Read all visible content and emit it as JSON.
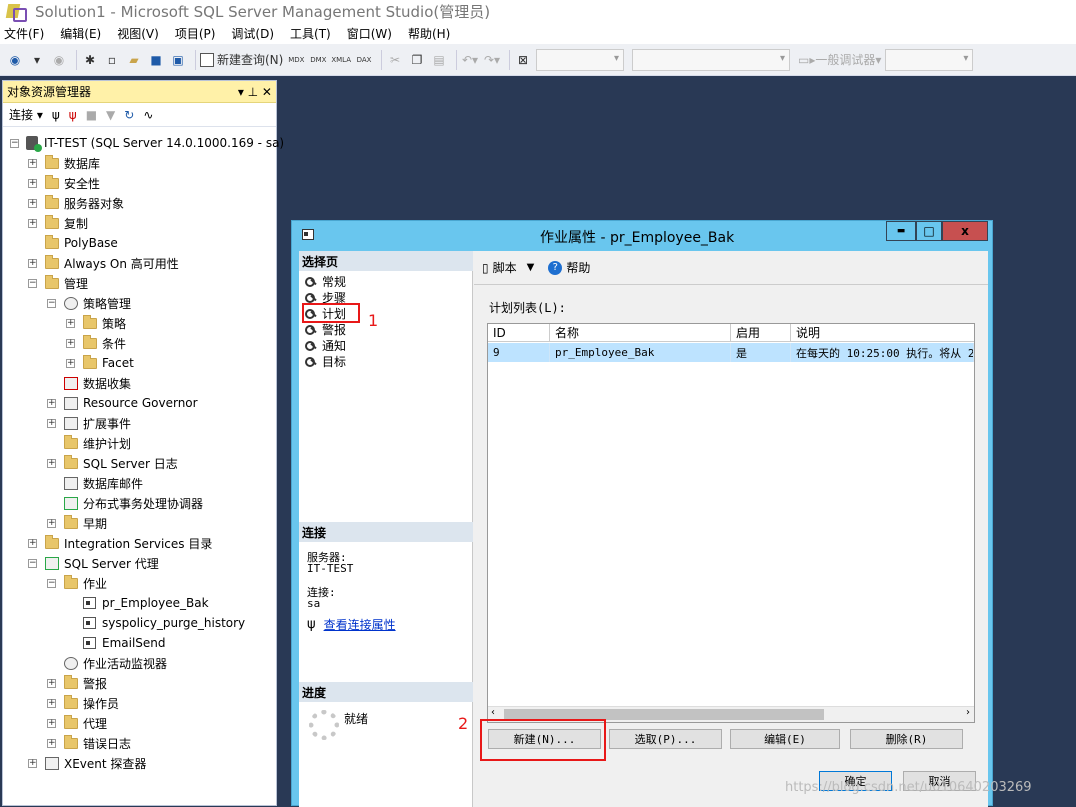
{
  "window": {
    "title": "Solution1 - Microsoft SQL Server Management Studio(管理员)"
  },
  "menu": [
    "文件(F)",
    "编辑(E)",
    "视图(V)",
    "项目(P)",
    "调试(D)",
    "工具(T)",
    "窗口(W)",
    "帮助(H)"
  ],
  "toolbar": {
    "new_query": "新建查询(N)",
    "mdx": "MDX",
    "dmx": "DMX",
    "xmla": "XMLA",
    "dax": "DAX",
    "debugger": "一般调试器"
  },
  "object_explorer": {
    "title": "对象资源管理器",
    "pin": "▾ ⊥ ✕",
    "connect": "连接",
    "nodes": [
      "IT-TEST (SQL Server 14.0.1000.169 - sa)",
      "数据库",
      "安全性",
      "服务器对象",
      "复制",
      "PolyBase",
      "Always On 高可用性",
      "管理",
      "策略管理",
      "策略",
      "条件",
      "Facet",
      "数据收集",
      "Resource Governor",
      "扩展事件",
      "维护计划",
      "SQL Server 日志",
      "数据库邮件",
      "分布式事务处理协调器",
      "早期",
      "Integration Services 目录",
      "SQL Server 代理",
      "作业",
      "pr_Employee_Bak",
      "syspolicy_purge_history",
      "EmailSend",
      "作业活动监视器",
      "警报",
      "操作员",
      "代理",
      "错误日志",
      "XEvent 探查器"
    ]
  },
  "dialog": {
    "title": "作业属性 - pr_Employee_Bak",
    "win_min": "▬",
    "win_max": "□",
    "win_close": "x",
    "select_page": "选择页",
    "pages": [
      "常规",
      "步骤",
      "计划",
      "警报",
      "通知",
      "目标"
    ],
    "annotation_1": "1",
    "annotation_2": "2",
    "connection": {
      "header": "连接",
      "server_label": "服务器:",
      "server_value": "IT-TEST",
      "conn_label": "连接:",
      "conn_value": "sa",
      "view_link": "查看连接属性"
    },
    "progress": {
      "header": "进度",
      "status": "就绪"
    },
    "script": "脚本",
    "help": "帮助",
    "schedule_list_label": "计划列表(L):",
    "columns": [
      "ID",
      "名称",
      "启用",
      "说明"
    ],
    "rows": [
      {
        "id": "9",
        "name": "pr_Employee_Bak",
        "enabled": "是",
        "desc": "在每天的 10:25:00 执行。将从 2"
      }
    ],
    "buttons": {
      "new": "新建(N)...",
      "pick": "选取(P)...",
      "edit": "编辑(E)",
      "delete": "删除(R)",
      "ok": "确定",
      "cancel": "取消"
    }
  },
  "watermark": "https://blog.csdn.net/u010640203269"
}
